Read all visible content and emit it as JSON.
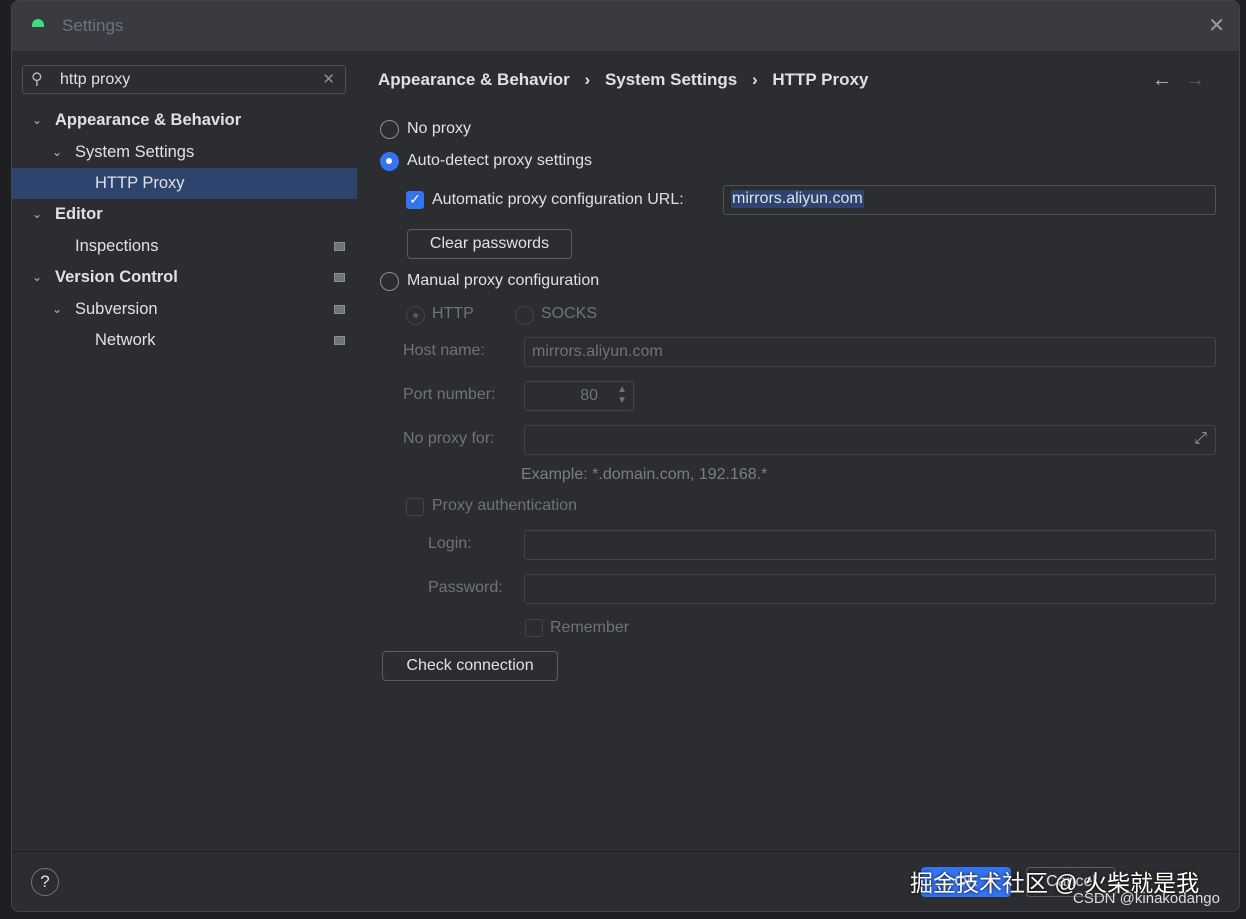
{
  "window": {
    "title": "Settings"
  },
  "search": {
    "value": "http proxy"
  },
  "tree": [
    {
      "label": "Appearance & Behavior",
      "level": 0
    },
    {
      "label": "System Settings",
      "level": 1
    },
    {
      "label": "HTTP Proxy",
      "level": 2
    },
    {
      "label": "Editor",
      "level": 0
    },
    {
      "label": "Inspections",
      "level": 1
    },
    {
      "label": "Version Control",
      "level": 0
    },
    {
      "label": "Subversion",
      "level": 1
    },
    {
      "label": "Network",
      "level": 2
    }
  ],
  "breadcrumb": [
    "Appearance & Behavior",
    "System Settings",
    "HTTP Proxy"
  ],
  "breadcrumb_sep": "›",
  "proxy": {
    "no_proxy": "No proxy",
    "auto_detect": "Auto-detect proxy settings",
    "auto_url_label": "Automatic proxy configuration URL:",
    "auto_url_value": "mirrors.aliyun.com",
    "clear_passwords": "Clear passwords",
    "manual": "Manual proxy configuration",
    "http": "HTTP",
    "socks": "SOCKS",
    "host_label": "Host name:",
    "host_value": "mirrors.aliyun.com",
    "port_label": "Port number:",
    "port_value": "80",
    "no_proxy_for_label": "No proxy for:",
    "example": "Example: *.domain.com, 192.168.*",
    "proxy_auth": "Proxy authentication",
    "login_label": "Login:",
    "password_label": "Password:",
    "remember": "Remember",
    "check_connection": "Check connection"
  },
  "footer": {
    "ok": "OK",
    "cancel": "Cancel",
    "help": "?"
  },
  "watermark": {
    "line1": "掘金技术社区 @ 火柴就是我",
    "line2": "CSDN @kinakodango"
  },
  "colors": {
    "accent": "#3574f0",
    "selection": "#2e436e"
  }
}
